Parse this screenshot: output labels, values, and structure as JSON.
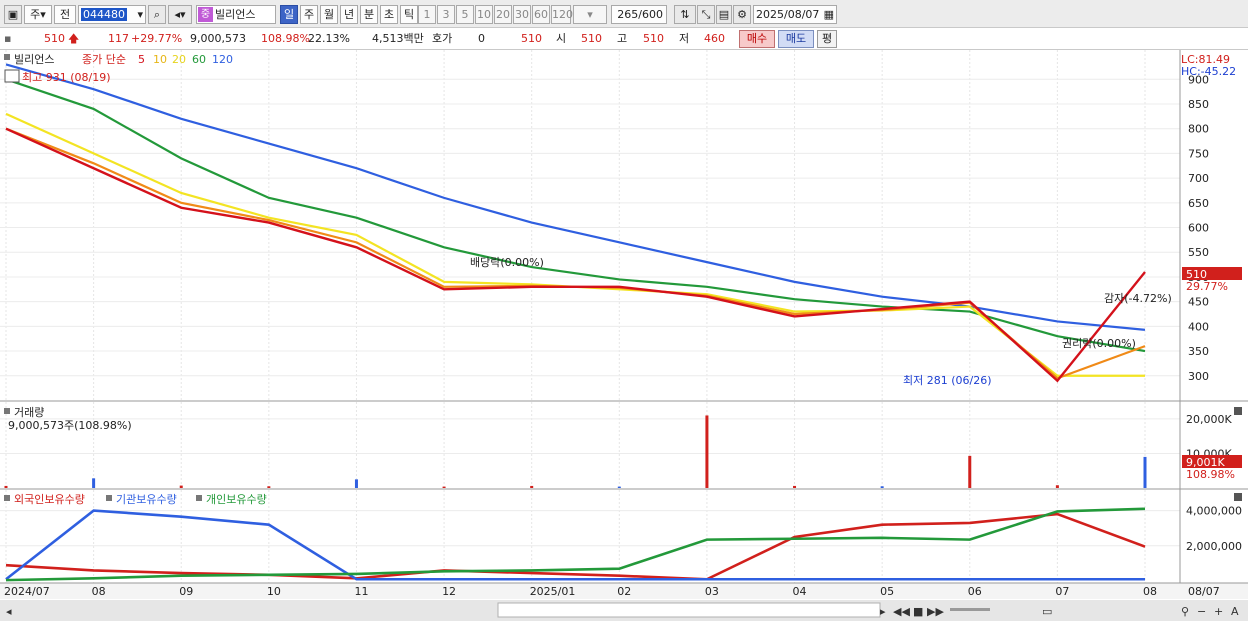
{
  "toolbar": {
    "period_select": "주",
    "prev_label": "전",
    "code_value": "044480",
    "stock_name": "빌리언스",
    "stock_tag": "중",
    "periods": [
      "일",
      "주",
      "월",
      "년",
      "분",
      "초",
      "틱"
    ],
    "active_period": "일",
    "intervals": [
      "1",
      "3",
      "5",
      "10",
      "20",
      "30",
      "60",
      "120"
    ],
    "count_value": "265",
    "count_total": "/600",
    "date_value": "2025/08/07"
  },
  "quote": {
    "price": "510",
    "change": "117",
    "change_pct": "+29.77%",
    "volume": "9,000,573",
    "volume_ratio": "108.98%",
    "turnover": "22.13%",
    "amount": "4,513백만",
    "hoga_label": "호가",
    "hoga_value": "0",
    "ask_value": "510",
    "open_label": "시",
    "open_value": "510",
    "high_label": "고",
    "high_value": "510",
    "low_label": "저",
    "low_value": "460",
    "buy_label": "매수",
    "sell_label": "매도",
    "eval_label": "평"
  },
  "price_panel": {
    "title": "빌리언스",
    "ma_label": "종가 단순",
    "ma_periods": [
      "5",
      "10",
      "20",
      "60",
      "120"
    ],
    "ma_colors": [
      "#d4111b",
      "#f08a17",
      "#f3e423",
      "#23993a",
      "#2f5fe0"
    ],
    "high_marker": "최고 931 (08/19)",
    "low_marker": "최저 281 (06/26)",
    "dividend_marker": "배당락(0.00%)",
    "reduction_marker": "감자(-4.72%)",
    "rights_marker": "권리락(0.00%)",
    "lc_label": "LC:81.49",
    "hc_label": "HC:-45.22",
    "last_price_tag": "510",
    "last_change_tag": "29.77%",
    "y_ticks": [
      "900",
      "850",
      "800",
      "750",
      "700",
      "650",
      "600",
      "550",
      "500",
      "450",
      "400",
      "350",
      "300"
    ]
  },
  "volume_panel": {
    "title": "거래량",
    "summary": "9,000,573주(108.98%)",
    "y_ticks": [
      "20,000K",
      "10,000K"
    ],
    "last_tag": "9,001K",
    "last_pct": "108.98%"
  },
  "holdings_panel": {
    "legend": [
      {
        "label": "외국인보유수량",
        "color": "#d1201c"
      },
      {
        "label": "기관보유수량",
        "color": "#2f5fe0"
      },
      {
        "label": "개인보유수량",
        "color": "#23993a"
      }
    ],
    "y_ticks": [
      "4,000,000",
      "2,000,000"
    ]
  },
  "x_axis": {
    "labels": [
      "2024/07",
      "08",
      "09",
      "10",
      "11",
      "12",
      "2025/01",
      "02",
      "03",
      "04",
      "05",
      "06",
      "07",
      "08"
    ],
    "right_label": "08/07"
  },
  "chart_data": [
    {
      "type": "line",
      "title": "빌리언스",
      "x": [
        "2024/07",
        "08",
        "09",
        "10",
        "11",
        "12",
        "2025/01",
        "02",
        "03",
        "04",
        "05",
        "06",
        "07",
        "08/07"
      ],
      "ylim": [
        255,
        935
      ],
      "series": [
        {
          "name": "5",
          "values": [
            800,
            720,
            640,
            610,
            560,
            475,
            480,
            480,
            460,
            420,
            435,
            450,
            290,
            510
          ]
        },
        {
          "name": "10",
          "values": [
            800,
            730,
            650,
            615,
            570,
            480,
            482,
            478,
            462,
            425,
            433,
            448,
            295,
            360
          ]
        },
        {
          "name": "20",
          "values": [
            830,
            750,
            670,
            620,
            585,
            490,
            485,
            475,
            465,
            430,
            432,
            440,
            300,
            300
          ]
        },
        {
          "name": "60",
          "values": [
            900,
            840,
            740,
            660,
            620,
            560,
            520,
            495,
            480,
            455,
            440,
            430,
            380,
            350
          ]
        },
        {
          "name": "120",
          "values": [
            930,
            880,
            820,
            770,
            720,
            660,
            610,
            570,
            530,
            490,
            460,
            440,
            410,
            393
          ]
        }
      ]
    },
    {
      "type": "bar",
      "title": "거래량",
      "categories": [
        "2024/07",
        "08",
        "09",
        "10",
        "11",
        "12",
        "2025/01",
        "02",
        "03",
        "04",
        "05",
        "06",
        "07",
        "08"
      ],
      "values": [
        600,
        2800,
        700,
        500,
        2500,
        400,
        600,
        400,
        21000,
        600,
        500,
        9300,
        800,
        9001
      ],
      "unit": "K"
    },
    {
      "type": "line",
      "title": "보유수량",
      "x": [
        "2024/07",
        "08",
        "09",
        "10",
        "11",
        "12",
        "2025/01",
        "02",
        "03",
        "04",
        "05",
        "06",
        "07",
        "08"
      ],
      "ylim": [
        0,
        4600000
      ],
      "series": [
        {
          "name": "외국인보유수량",
          "values": [
            900000,
            600000,
            450000,
            350000,
            150000,
            600000,
            450000,
            300000,
            100000,
            2500000,
            3200000,
            3300000,
            3800000,
            1950000
          ]
        },
        {
          "name": "기관보유수량",
          "values": [
            100000,
            4000000,
            3650000,
            3200000,
            100000,
            100000,
            100000,
            100000,
            100000,
            100000,
            100000,
            100000,
            100000,
            100000
          ]
        },
        {
          "name": "개인보유수량",
          "values": [
            50000,
            150000,
            300000,
            350000,
            400000,
            550000,
            600000,
            700000,
            2350000,
            2400000,
            2450000,
            2350000,
            3950000,
            4100000
          ]
        }
      ]
    }
  ]
}
